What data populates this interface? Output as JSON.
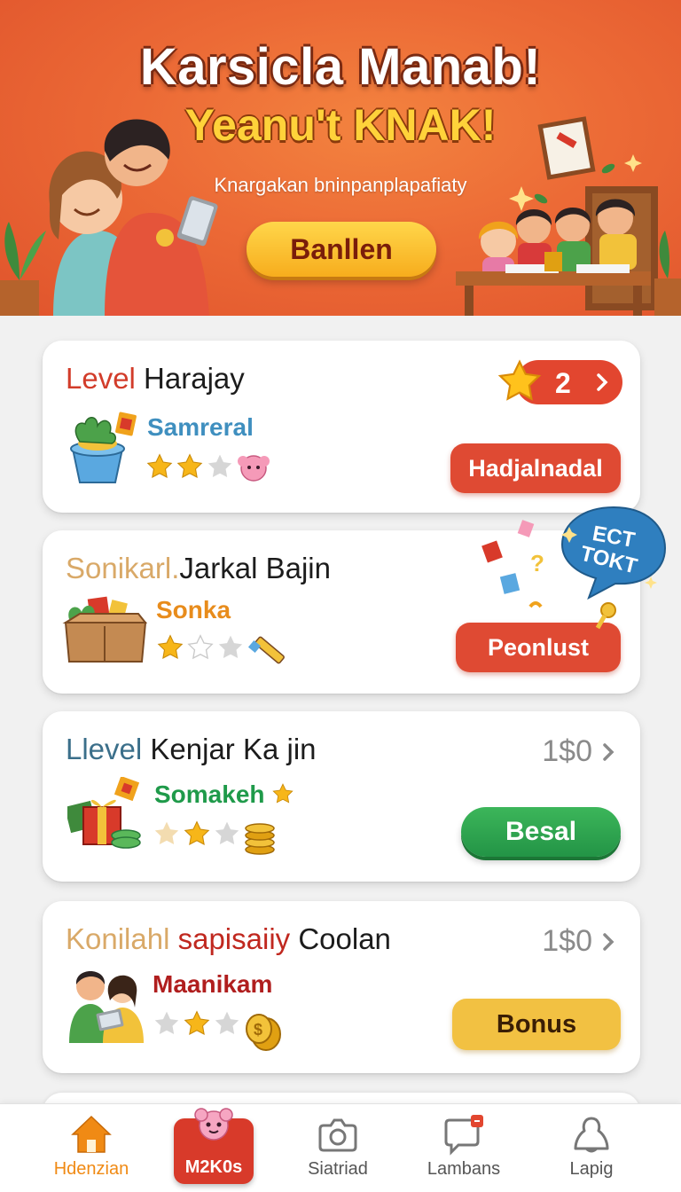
{
  "hero": {
    "title": "Karsicla Manab!",
    "subtitle": "Yeanu't KNAK!",
    "tagline": "Knargakan bninpanplapafiaty",
    "button_label": "Banllen"
  },
  "cards": [
    {
      "title_highlight": "Level",
      "title_rest": " Harajay",
      "highlight_color": "#d23c2a",
      "subtitle": "Samreral",
      "subtitle_color": "#3f8fbf",
      "rating": 2,
      "icon": "plant-pot-icon",
      "badge_value": "2",
      "button_label": "Hadjalnadal",
      "button_color": "#df4a33"
    },
    {
      "title_highlight": "Sonikarl.",
      "title_rest": "Jarkal Bajin",
      "highlight_color": "#d9a968",
      "subtitle": "Sonka",
      "subtitle_color": "#e88c1c",
      "rating": 1,
      "icon": "box-icon",
      "button_label": "Peonlust",
      "button_color": "#df4a33",
      "bubble_text_1": "ECT",
      "bubble_text_2": "TOKT"
    },
    {
      "title_highlight": "Llevel",
      "title_rest": " Kenjar Ka jin",
      "highlight_color": "#3b6f8a",
      "subtitle": "Somakeh",
      "subtitle_color": "#1f9a4a",
      "rating": 2,
      "icon": "gift-icon",
      "price": "1$0",
      "button_label": "Besal",
      "button_color": "#2aa14c"
    },
    {
      "title_highlight": "Konilahl",
      "title_rest_colored": " sapisaiiy",
      "title_rest": " Coolan",
      "highlight_color": "#d9a968",
      "rest_colored_color": "#c0281f",
      "subtitle": "Maanikam",
      "subtitle_color": "#b01e1e",
      "rating": 2,
      "icon": "kids-icon",
      "price": "1$0",
      "button_label": "Bonus",
      "button_color": "#f2c142"
    }
  ],
  "nav": {
    "items": [
      {
        "label": "Hdenzian",
        "icon": "home-icon",
        "active": true
      },
      {
        "label": "M2K0s",
        "icon": "mascot-icon",
        "active": false
      },
      {
        "label": "Siatriad",
        "icon": "camera-icon",
        "active": false
      },
      {
        "label": "Lambans",
        "icon": "chat-icon",
        "active": false
      },
      {
        "label": "Lapig",
        "icon": "bell-icon",
        "active": false
      }
    ],
    "active_color": "#f08a14"
  },
  "colors": {
    "accent": "#e2462f",
    "hero_bg": "#ec6a36"
  }
}
